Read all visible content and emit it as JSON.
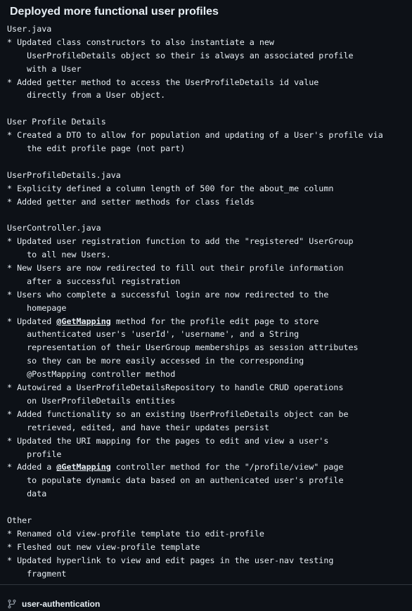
{
  "commit": {
    "title": "Deployed more functional user profiles",
    "body_lines": [
      {
        "text": "User.java"
      },
      {
        "text": "* Updated class constructors to also instantiate a new"
      },
      {
        "text": "    UserProfileDetails object so their is always an associated profile"
      },
      {
        "text": "    with a User"
      },
      {
        "text": "* Added getter method to access the UserProfileDetails id value"
      },
      {
        "text": "    directly from a User object."
      },
      {
        "text": ""
      },
      {
        "text": "User Profile Details"
      },
      {
        "text": "* Created a DTO to allow for population and updating of a User's profile via"
      },
      {
        "text": "    the edit profile page (not part)"
      },
      {
        "text": ""
      },
      {
        "text": "UserProfileDetails.java"
      },
      {
        "text": "* Explicity defined a column length of 500 for the about_me column"
      },
      {
        "text": "* Added getter and setter methods for class fields"
      },
      {
        "text": ""
      },
      {
        "text": "UserController.java"
      },
      {
        "text": "* Updated user registration function to add the \"registered\" UserGroup"
      },
      {
        "text": "    to all new Users."
      },
      {
        "text": "* New Users are now redirected to fill out their profile information"
      },
      {
        "text": "    after a successful registration"
      },
      {
        "text": "* Users who complete a successful login are now redirected to the"
      },
      {
        "text": "    homepage"
      },
      {
        "before": "* Updated ",
        "mention": "@GetMapping",
        "after": " method for the profile edit page to store"
      },
      {
        "text": "    authenticated user's 'userId', 'username', and a String"
      },
      {
        "text": "    representation of their UserGroup memberships as session attributes"
      },
      {
        "text": "    so they can be more easily accessed in the corresponding"
      },
      {
        "text": "    @PostMapping controller method"
      },
      {
        "text": "* Autowired a UserProfileDetailsRepository to handle CRUD operations"
      },
      {
        "text": "    on UserProfileDetails entities"
      },
      {
        "text": "* Added functionality so an existing UserProfileDetails object can be"
      },
      {
        "text": "    retrieved, edited, and have their updates persist"
      },
      {
        "text": "* Updated the URI mapping for the pages to edit and view a user's"
      },
      {
        "text": "    profile"
      },
      {
        "before": "* Added a ",
        "mention": "@GetMapping",
        "after": " controller method for the \"/profile/view\" page"
      },
      {
        "text": "    to populate dynamic data based on an authenicated user's profile"
      },
      {
        "text": "    data"
      },
      {
        "text": ""
      },
      {
        "text": "Other"
      },
      {
        "text": "* Renamed old view-profile template tio edit-profile"
      },
      {
        "text": "* Fleshed out new view-profile template"
      },
      {
        "text": "* Updated hyperlink to view and edit pages in the user-nav testing"
      },
      {
        "text": "    fragment"
      }
    ]
  },
  "branch": {
    "icon": "git-branch-icon",
    "name": "user-authentication"
  },
  "colors": {
    "background": "#0d1117",
    "text": "#e6edf3",
    "divider": "#30363d",
    "icon": "#8b949e"
  }
}
